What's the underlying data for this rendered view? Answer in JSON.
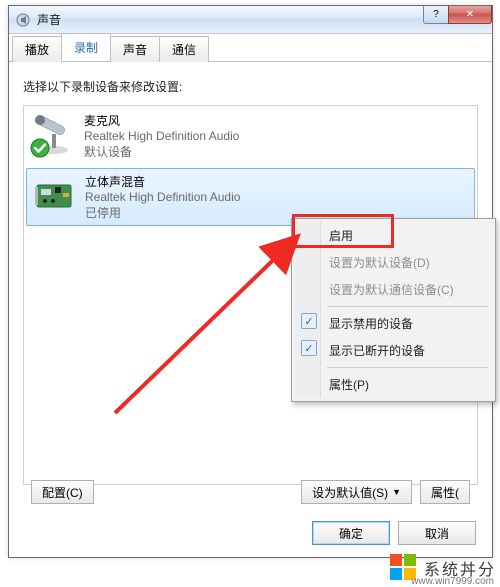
{
  "window": {
    "title": "声音",
    "help_icon": "?",
    "close_icon": "✕"
  },
  "tabs": [
    {
      "label": "播放"
    },
    {
      "label": "录制"
    },
    {
      "label": "声音"
    },
    {
      "label": "通信"
    }
  ],
  "active_tab": 1,
  "body": {
    "instruction": "选择以下录制设备来修改设置:"
  },
  "devices": [
    {
      "name": "麦克风",
      "sub": "Realtek High Definition Audio",
      "status": "默认设备",
      "default": true
    },
    {
      "name": "立体声混音",
      "sub": "Realtek High Definition Audio",
      "status": "已停用",
      "selected": true
    }
  ],
  "bottom_row": {
    "configure": "配置(C)",
    "set_default": "设为默认值(S)",
    "properties": "属性("
  },
  "dialog_buttons": {
    "ok": "确定",
    "cancel": "取消"
  },
  "context_menu": {
    "enable": "启用",
    "set_default_device": "设置为默认设备(D)",
    "set_default_comm": "设置为默认通信设备(C)",
    "show_disabled": "显示禁用的设备",
    "show_disconnected": "显示已断开的设备",
    "properties": "属性(P)"
  },
  "watermark": {
    "text": "系统丼分",
    "url": "www.win7999.com"
  }
}
